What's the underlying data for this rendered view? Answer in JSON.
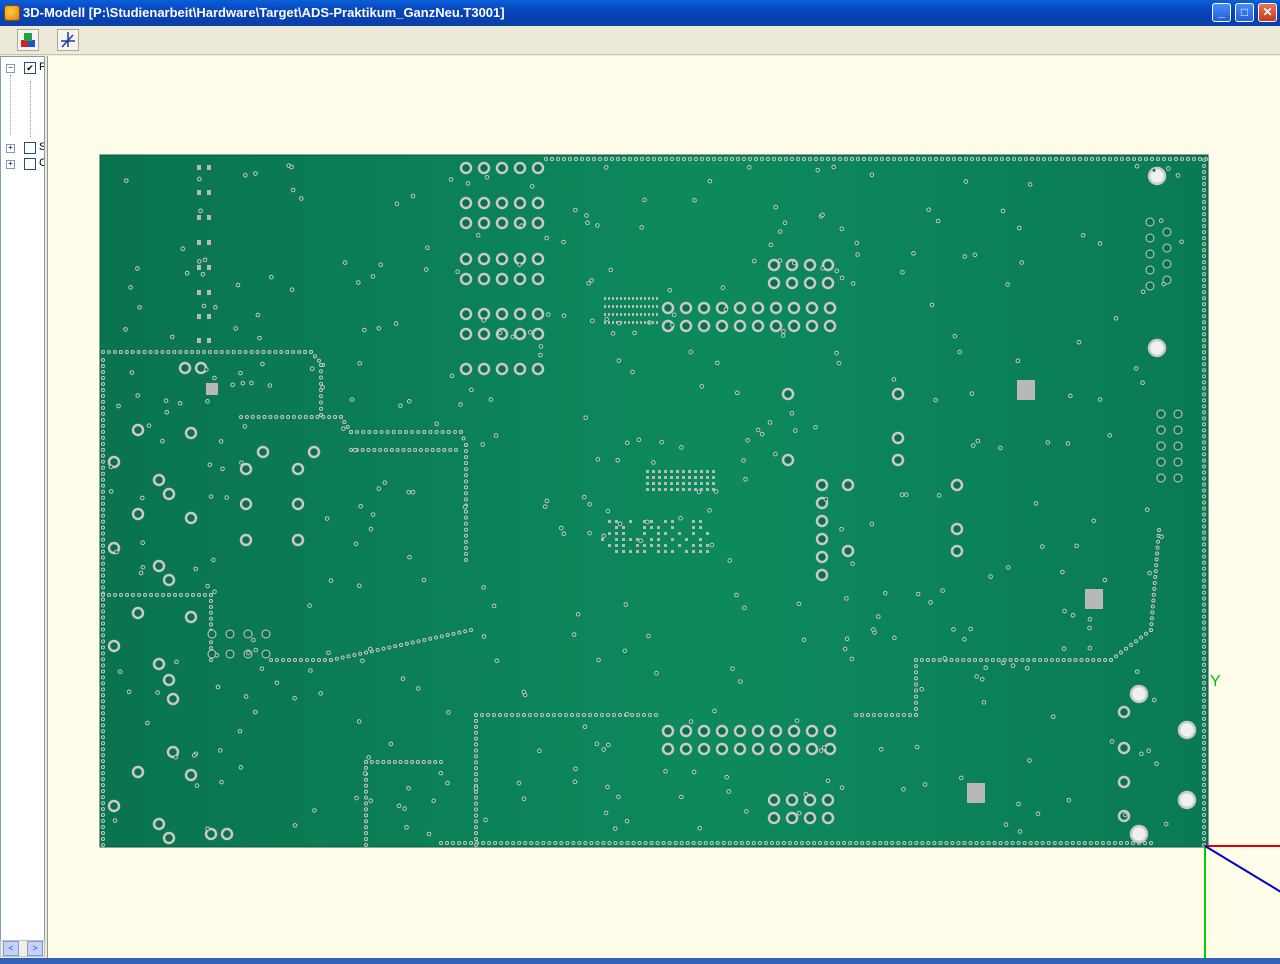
{
  "window": {
    "title": "3D-Modell  [P:\\Studienarbeit\\Hardware\\Target\\ADS-Praktikum_GanzNeu.T3001]"
  },
  "window_controls": {
    "minimize": "_",
    "maximize": "□",
    "close": "✕"
  },
  "toolbar": {
    "buttons": [
      {
        "icon": "layers-icon"
      },
      {
        "icon": "axes-icon"
      }
    ]
  },
  "tree": {
    "items": [
      {
        "expander": "−",
        "checked": "✔",
        "label": "F"
      },
      {
        "expander": "+",
        "checked": "",
        "label": "S"
      },
      {
        "expander": "+",
        "checked": "",
        "label": "C"
      }
    ]
  },
  "viewport": {
    "axis_label_y": "Y",
    "colors": {
      "board": "#0b7a52",
      "background": "#fffde9",
      "pad": "#c8c8c8",
      "axis_x": "#e00000",
      "axis_y": "#00d000",
      "axis_z": "#0000d0"
    }
  },
  "scroll": {
    "left": "<",
    "right": ">"
  }
}
